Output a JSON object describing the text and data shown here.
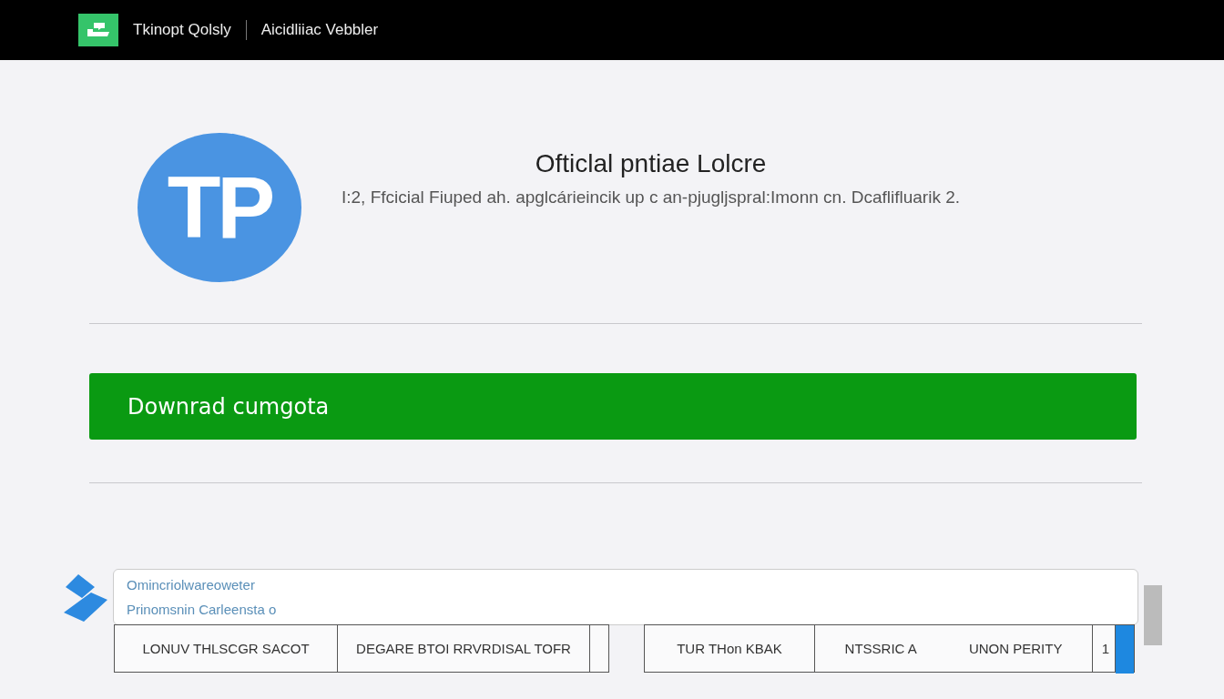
{
  "header": {
    "brand": "Tkinopt Qolsly",
    "section": "Aicidliiac Vebbler"
  },
  "hero": {
    "logo_text": "TP",
    "title": "Ofticlal pntiae Lolcre",
    "subtitle": "I:2, Ffcicial Fiuped ah. apglcárieincik up c an-pjugljspral:Imonn cn. Dcaflifluarik 2."
  },
  "download_button": {
    "label": "Downrad cumgota"
  },
  "info_card": {
    "lines": [
      "Omincriolwareoweter",
      "Prinomsnin Carleensta o"
    ]
  },
  "table_groups": [
    {
      "cells": [
        {
          "texts": [
            "LONUV THLSCGR SACOT"
          ]
        },
        {
          "texts": [
            "DEGARE BTOI RRVRDISAL TOFR"
          ]
        },
        {}
      ]
    },
    {
      "cells": [
        {
          "texts": [
            "TUR THon KBAK"
          ]
        },
        {
          "texts": [
            "NTSSRIC A",
            "UNON PERITY"
          ]
        },
        {
          "texts": [
            "1"
          ]
        }
      ]
    }
  ]
}
